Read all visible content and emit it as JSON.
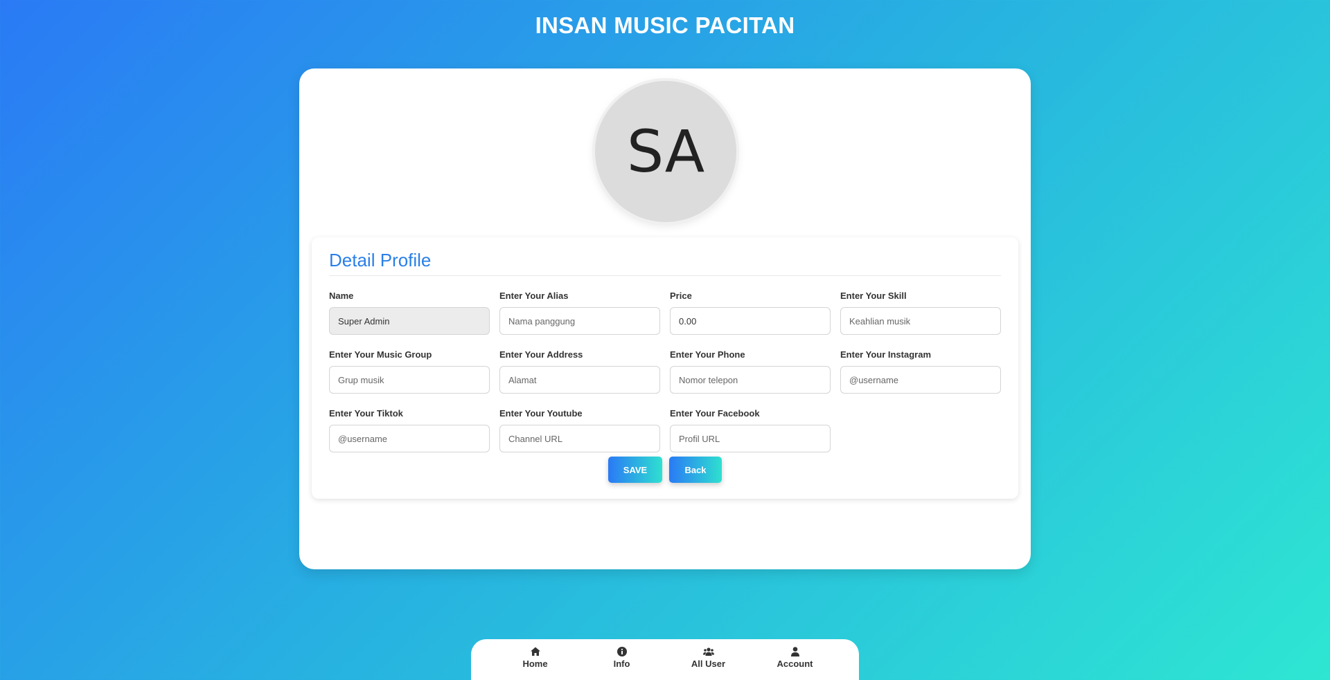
{
  "app": {
    "title": "INSAN MUSIC PACITAN"
  },
  "profile": {
    "avatar_initials": "SA"
  },
  "section": {
    "title": "Detail Profile"
  },
  "fields": [
    {
      "label": "Name",
      "value": "Super Admin",
      "placeholder": ""
    },
    {
      "label": "Enter Your Alias",
      "value": "",
      "placeholder": "Nama panggung"
    },
    {
      "label": "Price",
      "value": "0.00",
      "placeholder": ""
    },
    {
      "label": "Enter Your Skill",
      "value": "",
      "placeholder": "Keahlian musik"
    },
    {
      "label": "Enter Your Music Group",
      "value": "",
      "placeholder": "Grup musik"
    },
    {
      "label": "Enter Your Address",
      "value": "",
      "placeholder": "Alamat"
    },
    {
      "label": "Enter Your Phone",
      "value": "",
      "placeholder": "Nomor telepon"
    },
    {
      "label": "Enter Your Instagram",
      "value": "",
      "placeholder": "@username"
    },
    {
      "label": "Enter Your Tiktok",
      "value": "",
      "placeholder": "@username"
    },
    {
      "label": "Enter Your Youtube",
      "value": "",
      "placeholder": "Channel URL"
    },
    {
      "label": "Enter Your Facebook",
      "value": "",
      "placeholder": "Profil URL"
    }
  ],
  "actions": {
    "save_label": "SAVE",
    "back_label": "Back"
  },
  "nav": {
    "items": [
      {
        "label": "Home",
        "icon": "home-icon"
      },
      {
        "label": "Info",
        "icon": "info-icon"
      },
      {
        "label": "All User",
        "icon": "users-icon"
      },
      {
        "label": "Account",
        "icon": "user-icon"
      }
    ]
  },
  "colors": {
    "gradient_start": "#2a7af5",
    "gradient_end": "#2ee6d2",
    "accent_title": "#2a7fe8"
  }
}
